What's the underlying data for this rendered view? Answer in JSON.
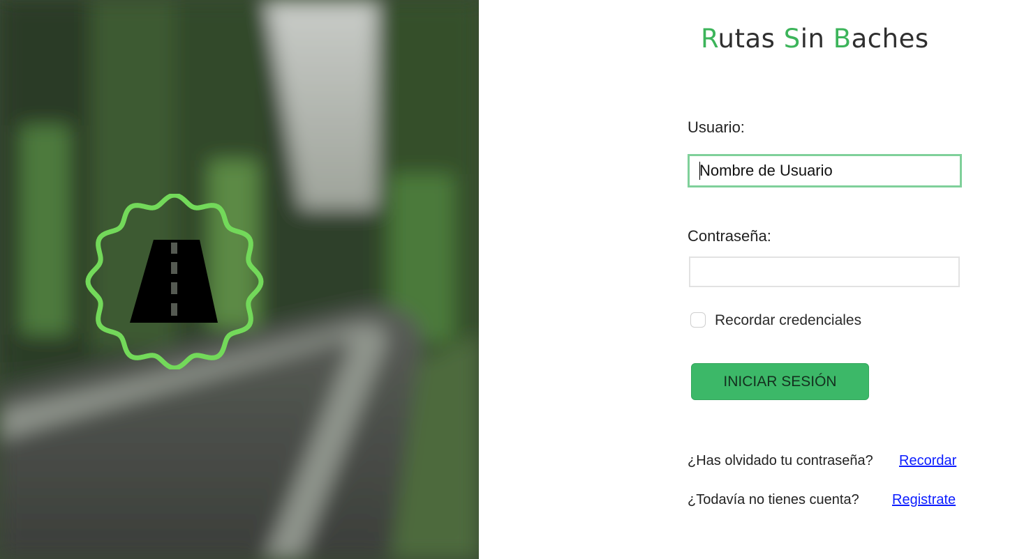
{
  "app": {
    "title_parts": [
      {
        "initial": "R",
        "rest": "utas"
      },
      {
        "initial": "S",
        "rest": "in"
      },
      {
        "initial": "B",
        "rest": "aches"
      }
    ]
  },
  "colors": {
    "accent": "#3cb45a",
    "button": "#3cb868",
    "input_focus_border": "#7fd09a",
    "link": "#0b1cff",
    "logo_ring": "#73d95a"
  },
  "hero": {
    "logo_icon": "road-badge-icon"
  },
  "form": {
    "username_label": "Usuario:",
    "username_value": "Nombre de Usuario",
    "password_label": "Contraseña:",
    "password_value": "",
    "remember_label": "Recordar credenciales",
    "remember_checked": false,
    "login_button": "INICIAR SESIÓN"
  },
  "help": {
    "forgot_text": "¿Has olvidado tu contraseña?",
    "forgot_link": "Recordar",
    "register_text": "¿Todavía no tienes cuenta?",
    "register_link": "Registrate"
  }
}
